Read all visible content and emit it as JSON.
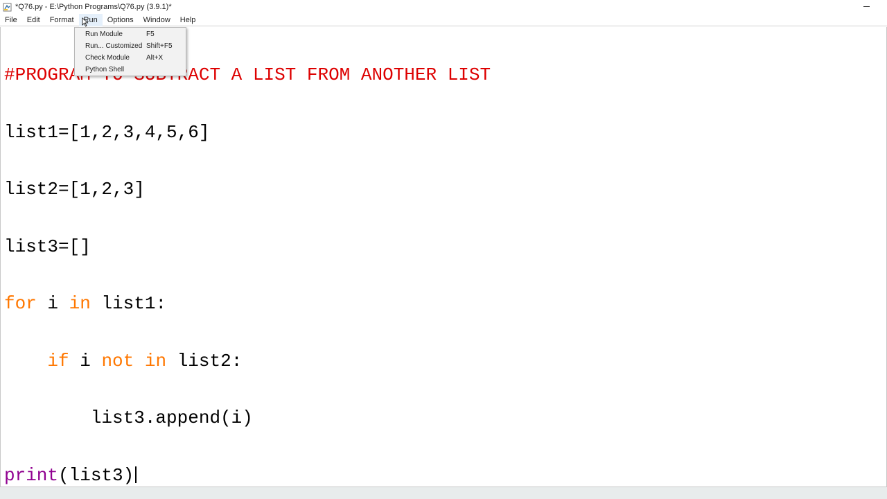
{
  "window": {
    "title": "*Q76.py - E:\\Python Programs\\Q76.py (3.9.1)*"
  },
  "menubar": {
    "items": [
      {
        "label": "File"
      },
      {
        "label": "Edit"
      },
      {
        "label": "Format"
      },
      {
        "label": "Run"
      },
      {
        "label": "Options"
      },
      {
        "label": "Window"
      },
      {
        "label": "Help"
      }
    ],
    "active": "Run"
  },
  "run_menu": {
    "items": [
      {
        "label": "Run Module",
        "shortcut": "F5"
      },
      {
        "label": "Run... Customized",
        "shortcut": "Shift+F5"
      },
      {
        "label": "Check Module",
        "shortcut": "Alt+X"
      },
      {
        "label": "Python Shell",
        "shortcut": ""
      }
    ]
  },
  "editor": {
    "lines": {
      "l1_comment": "#PROGRAM TO SUBTRACT A LIST FROM ANOTHER LIST",
      "l2": "list1=[1,2,3,4,5,6]",
      "l3": "list2=[1,2,3]",
      "l4": "list3=[]",
      "l5_kw1": "for",
      "l5_a": " i ",
      "l5_kw2": "in",
      "l5_b": " list1:",
      "l6_indent": "    ",
      "l6_kw1": "if",
      "l6_a": " i ",
      "l6_kw2": "not",
      "l6_sp": " ",
      "l6_kw3": "in",
      "l6_b": " list2:",
      "l7": "        list3.append(i)",
      "l8_builtin": "print",
      "l8_rest": "(list3)"
    }
  },
  "colors": {
    "comment": "#dd0000",
    "keyword": "#ff7700",
    "builtin": "#900090",
    "text": "#000000",
    "menu_bg": "#f2f2f2"
  },
  "icons": {
    "app": "python-idle-icon",
    "minimize": "minimize-icon",
    "mouse": "mouse-pointer-icon"
  }
}
